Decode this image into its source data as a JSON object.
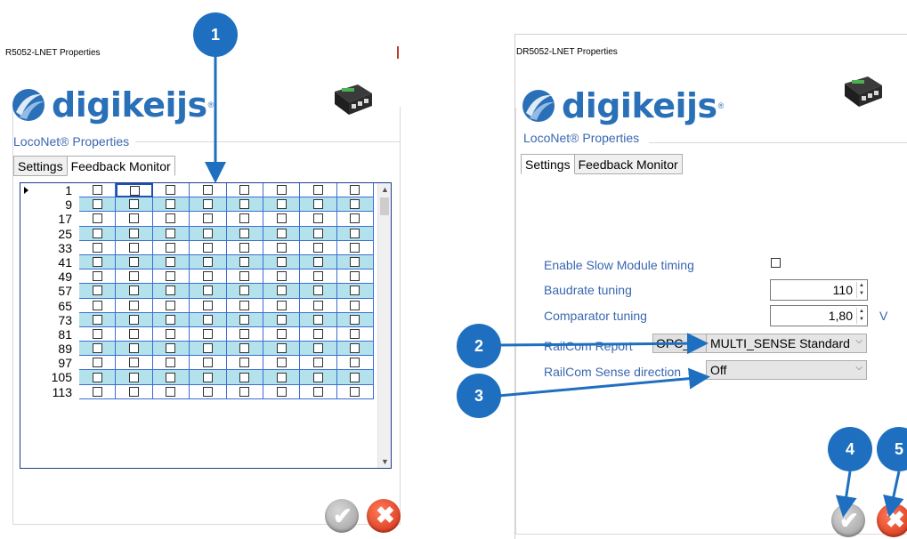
{
  "left_window": {
    "title": "R5052-LNET Properties",
    "logo_text": "digikeijs",
    "logo_reg": "®",
    "group_label": "LocoNet® Properties",
    "tabs": [
      {
        "label": "Settings",
        "active": false
      },
      {
        "label": "Feedback Monitor",
        "active": true
      }
    ],
    "grid_rows": [
      "1",
      "9",
      "17",
      "25",
      "33",
      "41",
      "49",
      "57",
      "65",
      "73",
      "81",
      "89",
      "97",
      "105",
      "113"
    ]
  },
  "right_window": {
    "title": "DR5052-LNET Properties",
    "logo_text": "digikeijs",
    "logo_reg": "®",
    "group_label": "LocoNet® Properties",
    "tabs": [
      {
        "label": "Settings",
        "active": true
      },
      {
        "label": "Feedback Monitor",
        "active": false
      }
    ],
    "settings": {
      "slow_module_label": "Enable Slow Module timing",
      "baudrate_label": "Baudrate tuning",
      "baudrate_value": "110",
      "comparator_label": "Comparator tuning",
      "comparator_value": "1,80",
      "comparator_unit": "V",
      "railcom_report_label": "RailCom Report",
      "railcom_report_button": "OPC_",
      "railcom_report_value": "MULTI_SENSE Standard",
      "railcom_sense_label": "RailCom Sense direction",
      "railcom_sense_value": "Off"
    }
  },
  "callouts": [
    "1",
    "2",
    "3",
    "4",
    "5"
  ],
  "icons": {
    "ok": "checkmark-icon",
    "cancel": "close-icon"
  },
  "colors": {
    "accent": "#1e6fbf",
    "label_blue": "#3a67b1",
    "grid_alt": "#b4e2ec",
    "cancel_red": "#d12d10"
  }
}
